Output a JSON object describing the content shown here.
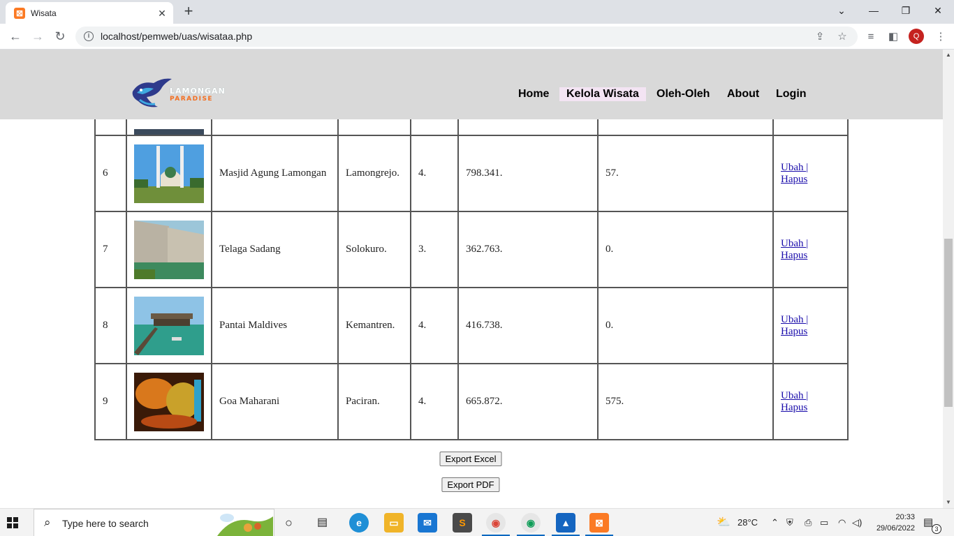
{
  "browser": {
    "tab_title": "Wisata",
    "tab_icon": "xampp-icon",
    "url": "localhost/pemweb/uas/wisataa.php",
    "profile_initial": "Q"
  },
  "site": {
    "logo_line1": "LAMONGAN",
    "logo_line2": "PARADISE",
    "nav": [
      {
        "label": "Home"
      },
      {
        "label": "Kelola Wisata"
      },
      {
        "label": "Oleh-Oleh"
      },
      {
        "label": "About"
      },
      {
        "label": "Login"
      }
    ],
    "active_nav": "Kelola Wisata"
  },
  "table": {
    "rows": [
      {
        "no": "6",
        "name": "Masjid Agung Lamongan",
        "location": "Lamongrejo.",
        "rating": "4.",
        "visitors": "798.341.",
        "extra": "57.",
        "edit": "Ubah",
        "delete": "Hapus"
      },
      {
        "no": "7",
        "name": "Telaga Sadang",
        "location": "Solokuro.",
        "rating": "3.",
        "visitors": "362.763.",
        "extra": "0.",
        "edit": "Ubah",
        "delete": "Hapus"
      },
      {
        "no": "8",
        "name": "Pantai Maldives",
        "location": "Kemantren.",
        "rating": "4.",
        "visitors": "416.738.",
        "extra": "0.",
        "edit": "Ubah",
        "delete": "Hapus"
      },
      {
        "no": "9",
        "name": "Goa Maharani",
        "location": "Paciran.",
        "rating": "4.",
        "visitors": "665.872.",
        "extra": "575.",
        "edit": "Ubah",
        "delete": "Hapus"
      }
    ],
    "action_separator": "|"
  },
  "buttons": {
    "export_excel": "Export Excel",
    "export_pdf": "Export PDF"
  },
  "taskbar": {
    "search_placeholder": "Type here to search",
    "temperature": "28°C",
    "time": "20:33",
    "date": "29/06/2022",
    "notification_count": "3"
  }
}
